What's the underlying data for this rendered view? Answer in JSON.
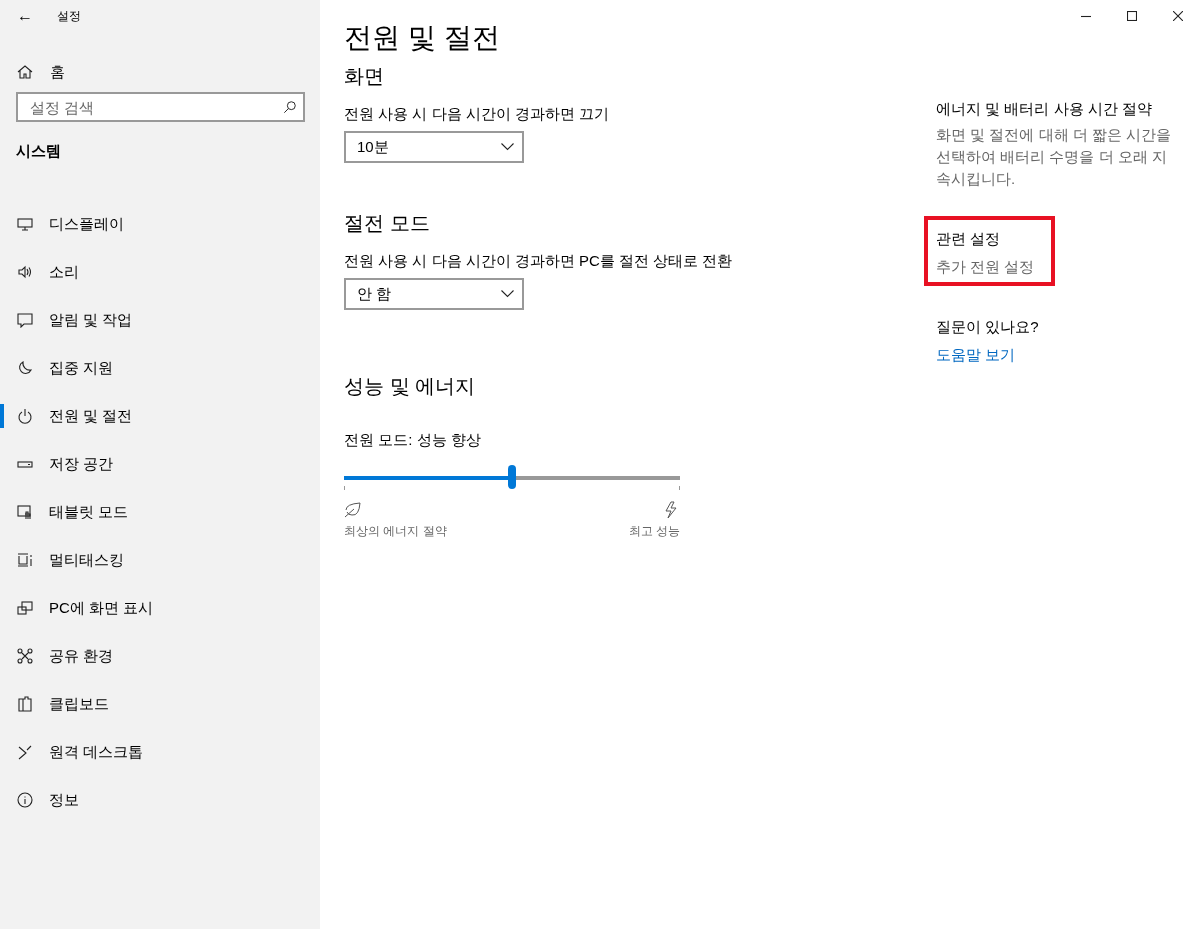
{
  "window": {
    "title": "설정",
    "back": "←"
  },
  "sidebar": {
    "home": "홈",
    "search": {
      "placeholder": "설정 검색"
    },
    "section": "시스템",
    "items": [
      {
        "label": "디스플레이",
        "selected": false
      },
      {
        "label": "소리",
        "selected": false
      },
      {
        "label": "알림 및 작업",
        "selected": false
      },
      {
        "label": "집중 지원",
        "selected": false
      },
      {
        "label": "전원 및 절전",
        "selected": true
      },
      {
        "label": "저장 공간",
        "selected": false
      },
      {
        "label": "태블릿 모드",
        "selected": false
      },
      {
        "label": "멀티태스킹",
        "selected": false
      },
      {
        "label": "PC에 화면 표시",
        "selected": false
      },
      {
        "label": "공유 환경",
        "selected": false
      },
      {
        "label": "클립보드",
        "selected": false
      },
      {
        "label": "원격 데스크톱",
        "selected": false
      },
      {
        "label": "정보",
        "selected": false
      }
    ]
  },
  "main": {
    "title": "전원 및 절전",
    "sections": [
      {
        "kind": "dropdown",
        "heading": "화면",
        "label": "전원 사용 시 다음 시간이 경과하면 끄기",
        "value": "10분"
      },
      {
        "kind": "dropdown",
        "heading": "절전 모드",
        "label": "전원 사용 시 다음 시간이 경과하면 PC를 절전 상태로 전환",
        "value": "안 함"
      },
      {
        "kind": "slider",
        "heading": "성능 및 에너지",
        "label": "전원 모드: 성능 향상",
        "level": 0.5,
        "min_label": "최상의 에너지 절약",
        "max_label": "최고 성능"
      }
    ]
  },
  "aside": [
    {
      "heading": "에너지 및 배터리 사용 시간 절약",
      "text": "화면 및 절전에 대해 더 짧은 시간을 선택하여 배터리 수명을 더 오래 지속시킵니다.",
      "highlighted": false
    },
    {
      "heading": "관련 설정",
      "link": "추가 전원 설정",
      "color": "#666666",
      "highlighted": true
    },
    {
      "heading": "질문이 있나요?",
      "link": "도움말 보기",
      "color": "#0067c0",
      "highlighted": false
    }
  ]
}
